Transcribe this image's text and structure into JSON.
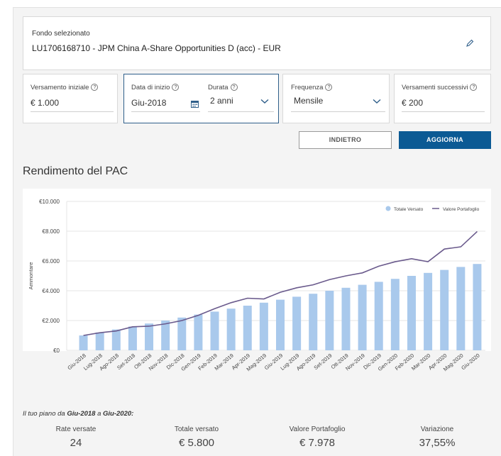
{
  "fund": {
    "label": "Fondo selezionato",
    "value": "LU1706168710 - JPM China A-Share Opportunities D (acc) - EUR"
  },
  "fields": {
    "initial": {
      "label": "Versamento iniziale",
      "value": "€ 1.000"
    },
    "start": {
      "label": "Data di inizio",
      "value": "Giu-2018"
    },
    "duration": {
      "label": "Durata",
      "value": "2 anni"
    },
    "frequency": {
      "label": "Frequenza",
      "value": "Mensile"
    },
    "subsequent": {
      "label": "Versamenti successivi",
      "value": "€ 200"
    }
  },
  "buttons": {
    "back": "INDIETRO",
    "update": "AGGIORNA"
  },
  "section_title": "Rendimento del PAC",
  "colors": {
    "bar": "#a9c9ec",
    "line": "#6a5a8c",
    "primary": "#0b5a94",
    "focus": "#2f5f8a"
  },
  "chart_data": {
    "type": "bar",
    "ylabel": "Ammontare",
    "ylim": [
      0,
      10000
    ],
    "y_ticks": [
      "€0",
      "€2.000",
      "€4.000",
      "€6.000",
      "€8.000",
      "€10.000"
    ],
    "legend_position": "top-right",
    "categories": [
      "Giu-2018",
      "Lug-2018",
      "Ago-2018",
      "Set-2018",
      "Ott-2018",
      "Nov-2018",
      "Dic-2018",
      "Gen-2019",
      "Feb-2019",
      "Mar-2019",
      "Apr-2019",
      "Mag-2019",
      "Giu-2019",
      "Lug-2019",
      "Ago-2019",
      "Set-2019",
      "Ott-2019",
      "Nov-2019",
      "Dic-2019",
      "Gen-2020",
      "Feb-2020",
      "Mar-2020",
      "Apr-2020",
      "Mag-2020",
      "Giu-2020"
    ],
    "series": [
      {
        "name": "Totale Versato",
        "kind": "bar",
        "values": [
          1000,
          1200,
          1400,
          1600,
          1800,
          2000,
          2200,
          2400,
          2600,
          2800,
          3000,
          3200,
          3400,
          3600,
          3800,
          4000,
          4200,
          4400,
          4600,
          4800,
          5000,
          5200,
          5400,
          5600,
          5800
        ]
      },
      {
        "name": "Valore Portafoglio",
        "kind": "line",
        "values": [
          1000,
          1180,
          1300,
          1580,
          1620,
          1780,
          2000,
          2350,
          2800,
          3200,
          3500,
          3450,
          3900,
          4200,
          4400,
          4750,
          5000,
          5200,
          5650,
          5950,
          6150,
          5950,
          6800,
          6950,
          7978
        ]
      }
    ]
  },
  "plan": {
    "prefix": "Il tuo piano da ",
    "from": "Giu-2018",
    "mid": " a ",
    "to": "Giu-2020",
    "suffix": ":"
  },
  "stats": [
    {
      "title": "Rate versate",
      "value": "24"
    },
    {
      "title": "Totale versato",
      "value": "€ 5.800"
    },
    {
      "title": "Valore Portafoglio",
      "value": "€ 7.978"
    },
    {
      "title": "Variazione",
      "value": "37,55%"
    }
  ]
}
